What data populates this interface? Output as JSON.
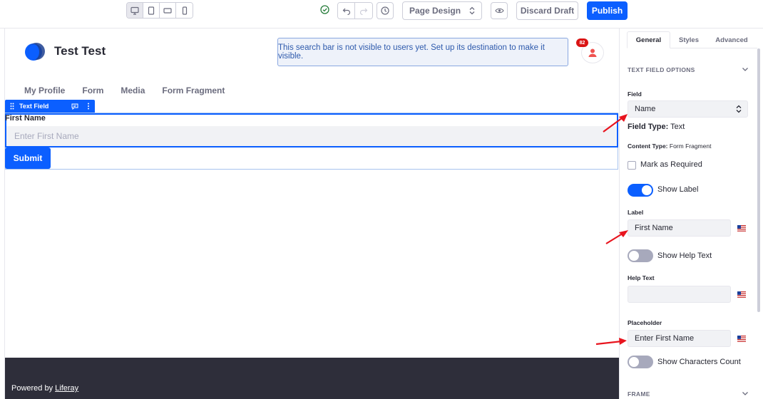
{
  "toolbar": {
    "devices": [
      "desktop-icon",
      "tablet-icon",
      "landscape-phone-icon",
      "portrait-phone-icon"
    ],
    "experience_label": "Page Design",
    "discard_label": "Discard Draft",
    "publish_label": "Publish"
  },
  "page": {
    "site_name": "Test Test",
    "search_notice": "This search bar is not visible to users yet. Set up its destination to make it visible.",
    "notification_count": "82",
    "nav_items": [
      "My Profile",
      "Form",
      "Media",
      "Form Fragment"
    ],
    "fragment_name": "Text Field",
    "field_label": "First Name",
    "field_placeholder": "Enter First Name",
    "submit_label": "Submit",
    "footer_prefix": "Powered by ",
    "footer_link": "Liferay"
  },
  "sidebar": {
    "tabs": [
      "General",
      "Styles",
      "Advanced"
    ],
    "active_tab": "General",
    "section_title": "TEXT FIELD OPTIONS",
    "field_label": "Field",
    "field_value": "Name",
    "field_type_key": "Field Type:",
    "field_type_value": "Text",
    "content_type_key": "Content Type:",
    "content_type_value": "Form Fragment",
    "mark_required_label": "Mark as Required",
    "show_label_label": "Show Label",
    "label_label": "Label",
    "label_value": "First Name",
    "show_help_label": "Show Help Text",
    "help_text_label": "Help Text",
    "help_text_value": "",
    "placeholder_label": "Placeholder",
    "placeholder_value": "Enter First Name",
    "show_chars_label": "Show Characters Count",
    "frame_title": "FRAME"
  },
  "colors": {
    "primary": "#0b5fff",
    "footer_bg": "#2e2e3a",
    "annotation_arrow": "#e8141e",
    "badge": "#da1414"
  }
}
